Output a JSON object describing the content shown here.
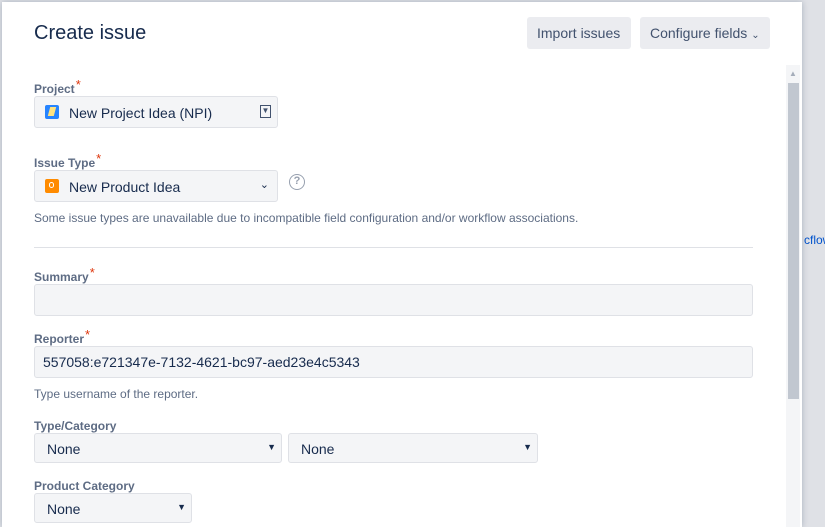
{
  "background": {
    "link_text": "cflow"
  },
  "dialog": {
    "title": "Create issue",
    "import_button": "Import issues",
    "configure_button": "Configure fields"
  },
  "project": {
    "label": "Project",
    "value": "New Project Idea (NPI)"
  },
  "issue_type": {
    "label": "Issue Type",
    "value": "New Product Idea",
    "note": "Some issue types are unavailable due to incompatible field configuration and/or workflow associations."
  },
  "summary": {
    "label": "Summary",
    "value": ""
  },
  "reporter": {
    "label": "Reporter",
    "value": "557058:e721347e-7132-4621-bc97-aed23e4c5343",
    "hint": "Type username of the reporter."
  },
  "type_category": {
    "label": "Type/Category",
    "first_value": "None",
    "second_value": "None"
  },
  "product_category": {
    "label": "Product Category",
    "value": "None"
  },
  "required_marker": "*",
  "icons": {
    "project": "project-avatar-icon",
    "issue_type": "lightbulb-icon",
    "help": "question-circle-icon",
    "dropdown": "chevron-down-icon"
  },
  "colors": {
    "required": "#de350b",
    "project_icon": "#2684ff",
    "issue_type_icon": "#ff8b00"
  }
}
